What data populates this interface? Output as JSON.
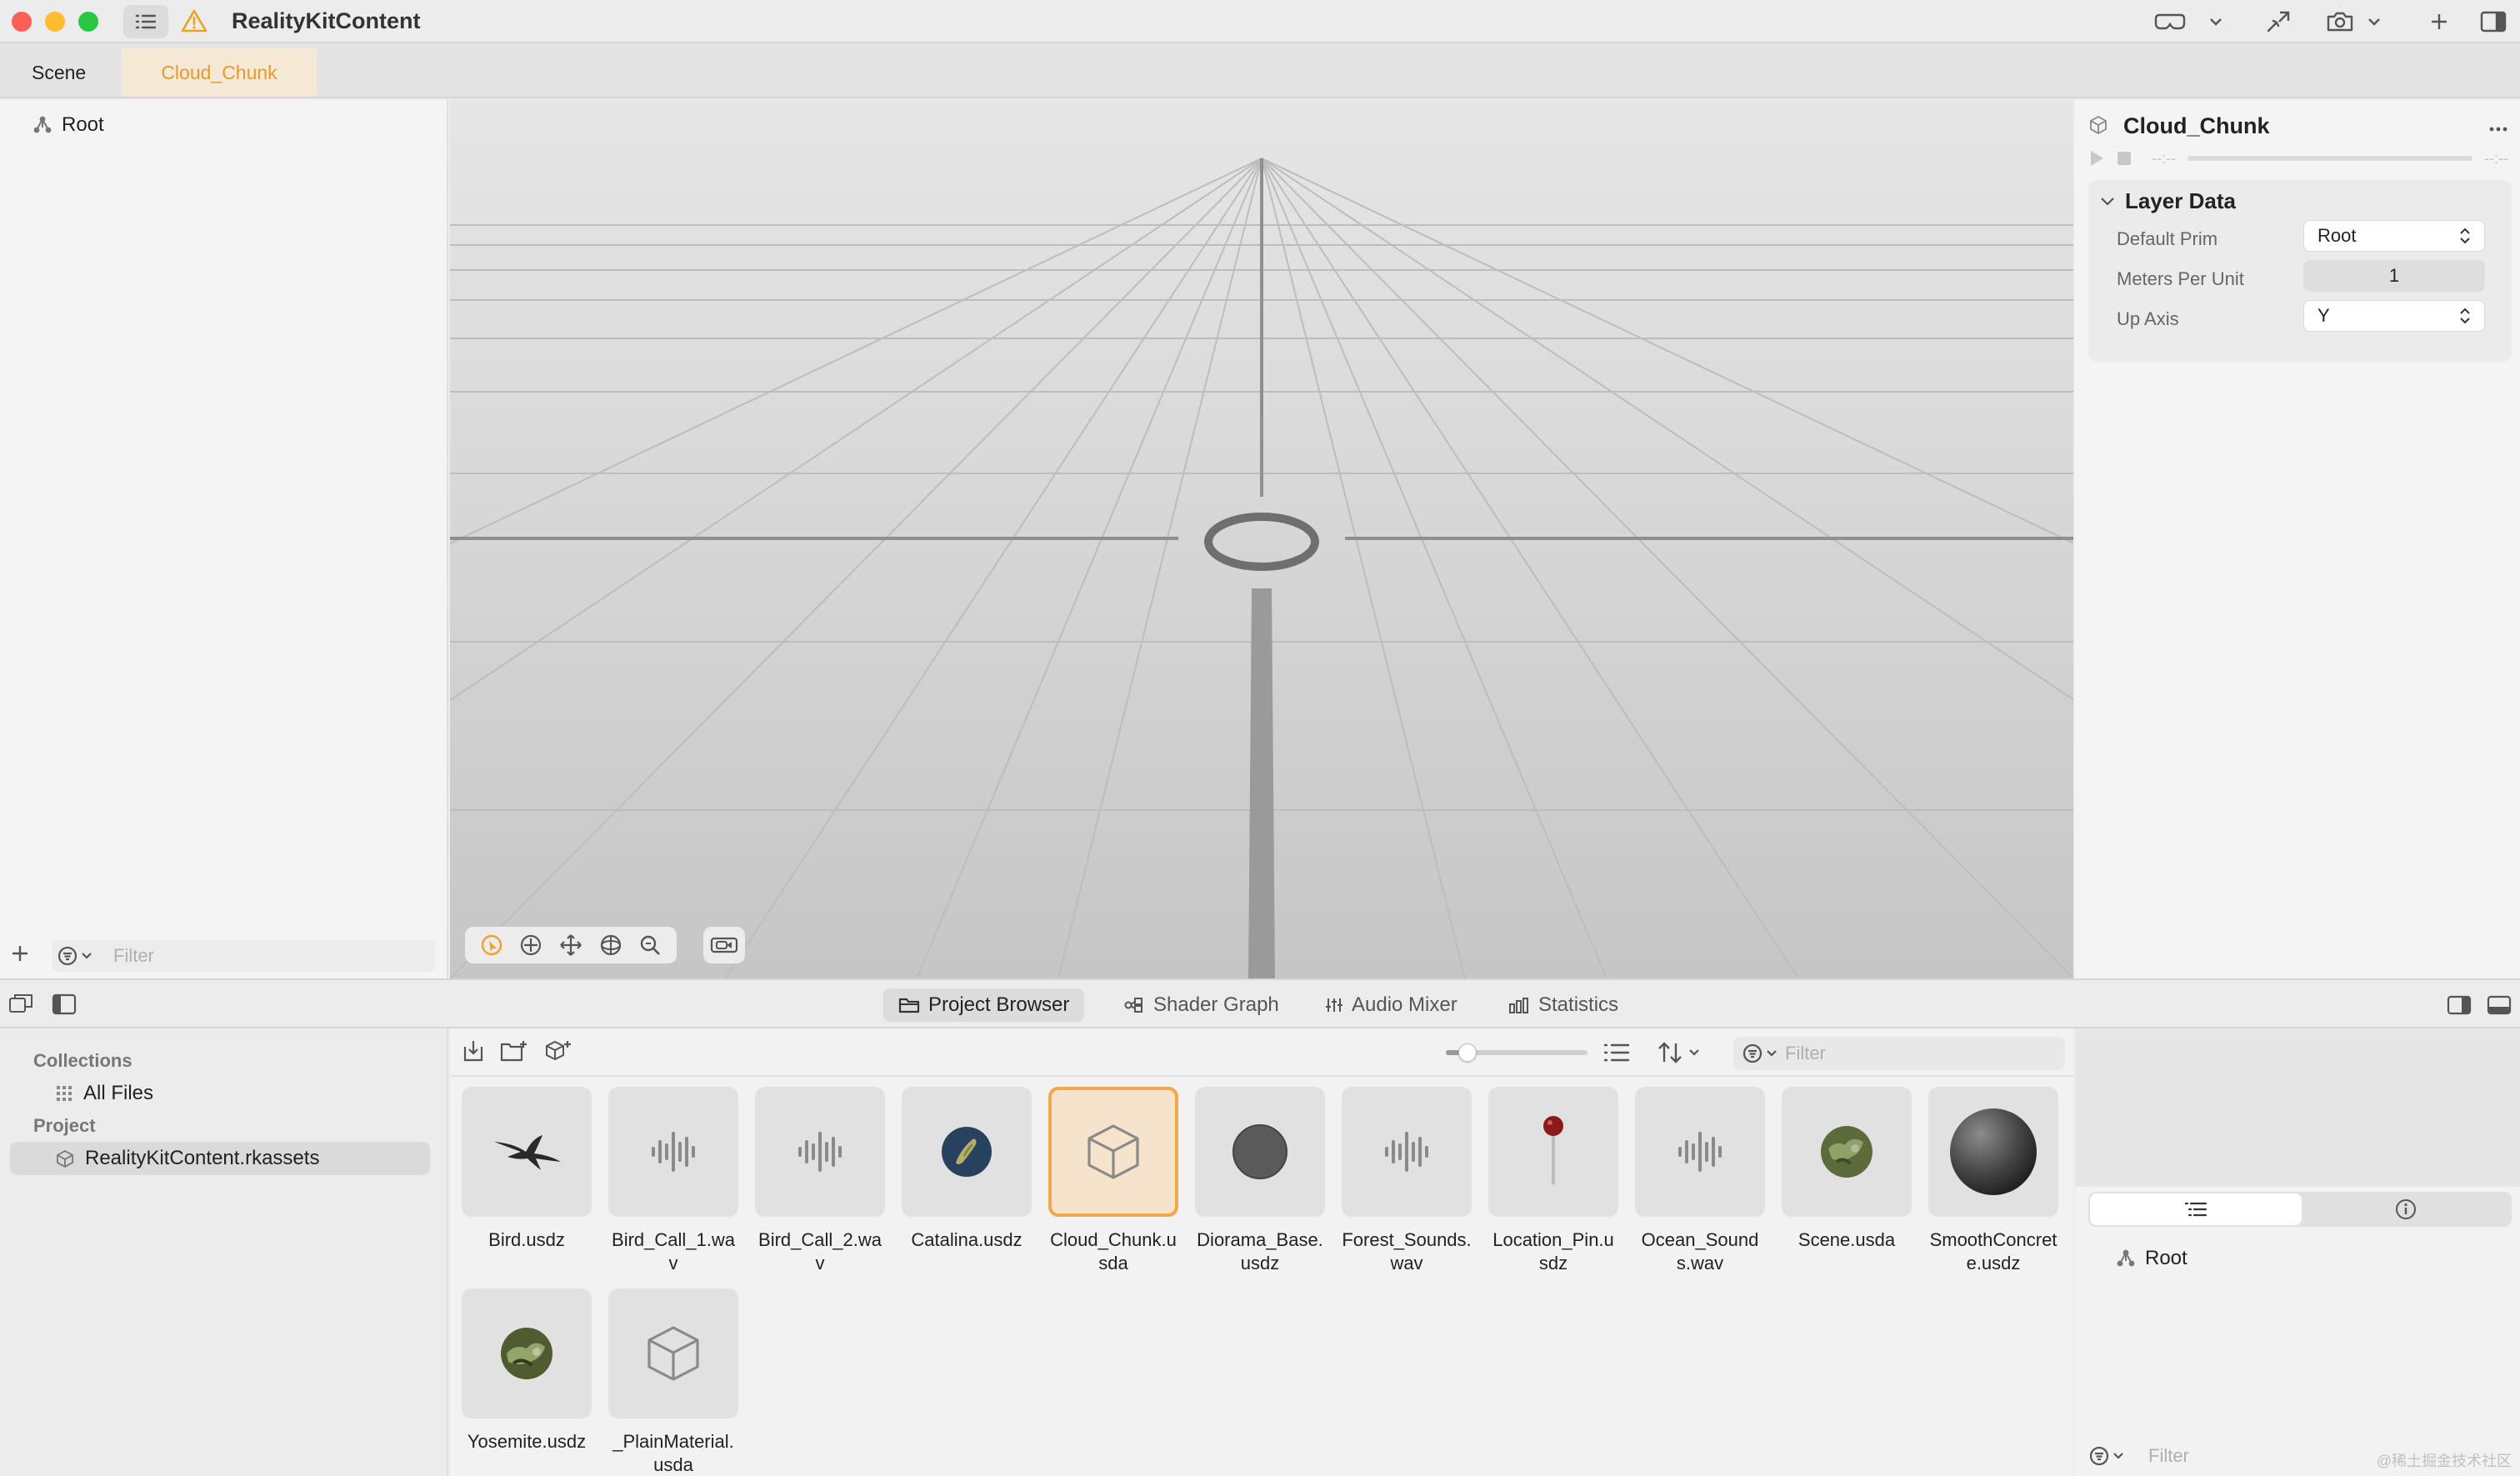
{
  "window": {
    "title": "RealityKitContent"
  },
  "tabs": [
    {
      "label": "Scene"
    },
    {
      "label": "Cloud_Chunk"
    }
  ],
  "outline": {
    "root_label": "Root",
    "filter_placeholder": "Filter"
  },
  "inspector": {
    "title": "Cloud_Chunk",
    "time_start": "--:--",
    "time_end": "--:--",
    "section": "Layer Data",
    "props": [
      {
        "label": "Default Prim",
        "value": "Root"
      },
      {
        "label": "Meters Per Unit",
        "value": "1"
      },
      {
        "label": "Up Axis",
        "value": "Y"
      }
    ]
  },
  "bottom_tabs": [
    {
      "label": "Project Browser"
    },
    {
      "label": "Shader Graph"
    },
    {
      "label": "Audio Mixer"
    },
    {
      "label": "Statistics"
    }
  ],
  "sidebar": {
    "collections_header": "Collections",
    "all_files": "All Files",
    "project_header": "Project",
    "project_item": "RealityKitContent.rkassets"
  },
  "browser": {
    "filter_placeholder": "Filter",
    "zoom_fraction": 0.15,
    "assets": [
      {
        "name": "Bird.usdz",
        "icon": "bird-icon"
      },
      {
        "name": "Bird_Call_1.wav",
        "icon": "audio-waveform-icon"
      },
      {
        "name": "Bird_Call_2.wav",
        "icon": "audio-waveform-icon"
      },
      {
        "name": "Catalina.usdz",
        "icon": "globe-thumbnail-icon"
      },
      {
        "name": "Cloud_Chunk.usda",
        "icon": "cube-icon",
        "selected": true
      },
      {
        "name": "Diorama_Base.usdz",
        "icon": "disc-thumbnail-icon"
      },
      {
        "name": "Forest_Sounds.wav",
        "icon": "audio-waveform-icon"
      },
      {
        "name": "Location_Pin.usdz",
        "icon": "pin-thumbnail-icon"
      },
      {
        "name": "Ocean_Sounds.wav",
        "icon": "audio-waveform-icon"
      },
      {
        "name": "Scene.usda",
        "icon": "terrain-thumbnail-icon"
      },
      {
        "name": "SmoothConcrete.usdz",
        "icon": "sphere-thumbnail-icon"
      },
      {
        "name": "Yosemite.usdz",
        "icon": "terrain-thumbnail-icon"
      },
      {
        "name": "_PlainMaterial.usda",
        "icon": "cube-icon"
      }
    ]
  },
  "right_panel": {
    "root_label": "Root",
    "filter_placeholder": "Filter"
  },
  "watermark": "@稀土掘金技术社区"
}
